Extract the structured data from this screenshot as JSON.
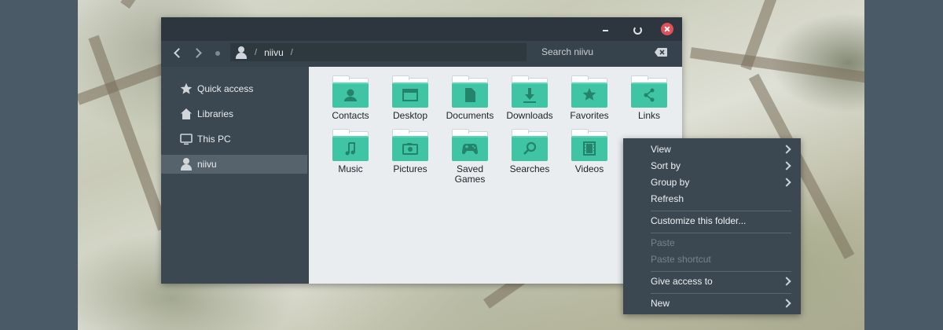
{
  "window": {
    "title_buttons": {
      "minimize": "minimize-icon",
      "maximize": "restore-icon",
      "close": "close-icon"
    },
    "close_color": "#e0505a"
  },
  "toolbar": {
    "path_separator": "/",
    "path_user": "niivu",
    "path_trailing_separator": "/",
    "search_placeholder": "Search niivu"
  },
  "sidebar": {
    "items": [
      {
        "label": "Quick access",
        "icon": "star-icon"
      },
      {
        "label": "Libraries",
        "icon": "home-icon"
      },
      {
        "label": "This PC",
        "icon": "monitor-icon"
      },
      {
        "label": "niivu",
        "icon": "user-icon",
        "active": true
      }
    ]
  },
  "folders": [
    {
      "label": "Contacts",
      "icon": "contact-icon"
    },
    {
      "label": "Desktop",
      "icon": "window-icon"
    },
    {
      "label": "Documents",
      "icon": "document-icon"
    },
    {
      "label": "Downloads",
      "icon": "download-icon"
    },
    {
      "label": "Favorites",
      "icon": "star-icon"
    },
    {
      "label": "Links",
      "icon": "share-icon"
    },
    {
      "label": "Music",
      "icon": "music-icon"
    },
    {
      "label": "Pictures",
      "icon": "camera-icon"
    },
    {
      "label": "Saved Games",
      "icon": "gamepad-icon"
    },
    {
      "label": "Searches",
      "icon": "search-icon"
    },
    {
      "label": "Videos",
      "icon": "film-icon"
    }
  ],
  "context_menu": {
    "items": [
      {
        "label": "View",
        "submenu": true
      },
      {
        "label": "Sort by",
        "submenu": true
      },
      {
        "label": "Group by",
        "submenu": true
      },
      {
        "label": "Refresh"
      },
      {
        "label": "Customize this folder..."
      },
      {
        "label": "Paste",
        "disabled": true
      },
      {
        "label": "Paste shortcut",
        "disabled": true
      },
      {
        "label": "Give access to",
        "submenu": true
      },
      {
        "label": "New",
        "submenu": true
      }
    ]
  },
  "colors": {
    "folder_accent": "#3fc4a4",
    "window_bg": "#3b4852",
    "content_bg": "#e9edf0"
  }
}
